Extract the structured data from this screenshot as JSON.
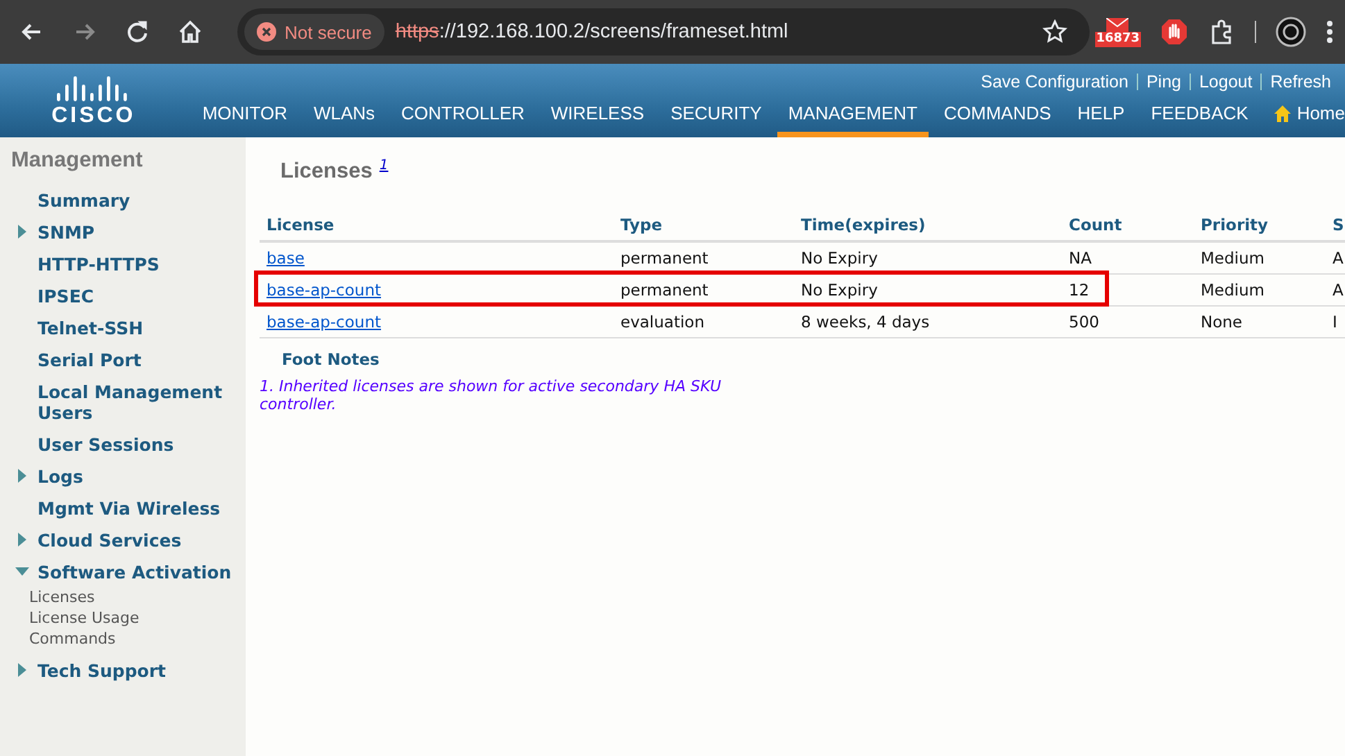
{
  "browser": {
    "security_label": "Not secure",
    "url_scheme": "https",
    "url_rest": "://192.168.100.2/screens/frameset.html",
    "extension_badge": "16873"
  },
  "header": {
    "logo": "CISCO",
    "top_links": [
      "Save Configuration",
      "Ping",
      "Logout",
      "Refresh"
    ],
    "nav": [
      {
        "label": "MONITOR",
        "selected": false
      },
      {
        "label": "WLANs",
        "selected": false
      },
      {
        "label": "CONTROLLER",
        "selected": false
      },
      {
        "label": "WIRELESS",
        "selected": false
      },
      {
        "label": "SECURITY",
        "selected": false
      },
      {
        "label": "MANAGEMENT",
        "selected": true
      },
      {
        "label": "COMMANDS",
        "selected": false
      },
      {
        "label": "HELP",
        "selected": false
      },
      {
        "label": "FEEDBACK",
        "selected": false
      }
    ],
    "home": "Home"
  },
  "sidebar": {
    "title": "Management",
    "items": [
      {
        "label": "Summary"
      },
      {
        "label": "SNMP",
        "expanded": false
      },
      {
        "label": "HTTP-HTTPS"
      },
      {
        "label": "IPSEC"
      },
      {
        "label": "Telnet-SSH"
      },
      {
        "label": "Serial Port"
      },
      {
        "label": "Local Management Users"
      },
      {
        "label": "User Sessions"
      },
      {
        "label": "Logs",
        "expanded": false
      },
      {
        "label": "Mgmt Via Wireless"
      },
      {
        "label": "Cloud Services",
        "expanded": false
      },
      {
        "label": "Software Activation",
        "expanded": true,
        "children": [
          {
            "label": "Licenses"
          },
          {
            "label": "License Usage"
          },
          {
            "label": "Commands"
          }
        ]
      },
      {
        "label": "Tech Support",
        "expanded": false
      }
    ]
  },
  "content": {
    "title": "Licenses",
    "footnote_ref": "1",
    "table": {
      "columns": [
        "License",
        "Type",
        "Time(expires)",
        "Count",
        "Priority",
        "S"
      ],
      "rows": [
        {
          "cells": [
            "base",
            "permanent",
            "No Expiry",
            "NA",
            "Medium",
            "A"
          ],
          "highlighted": false
        },
        {
          "cells": [
            "base-ap-count",
            "permanent",
            "No Expiry",
            "12",
            "Medium",
            "A"
          ],
          "highlighted": true
        },
        {
          "cells": [
            "base-ap-count",
            "evaluation",
            "8 weeks, 4 days",
            "500",
            "None",
            "I"
          ],
          "highlighted": false
        }
      ]
    },
    "footnotes_title": "Foot Notes",
    "footnotes": [
      "1. Inherited licenses are shown for active secondary HA SKU controller."
    ]
  }
}
